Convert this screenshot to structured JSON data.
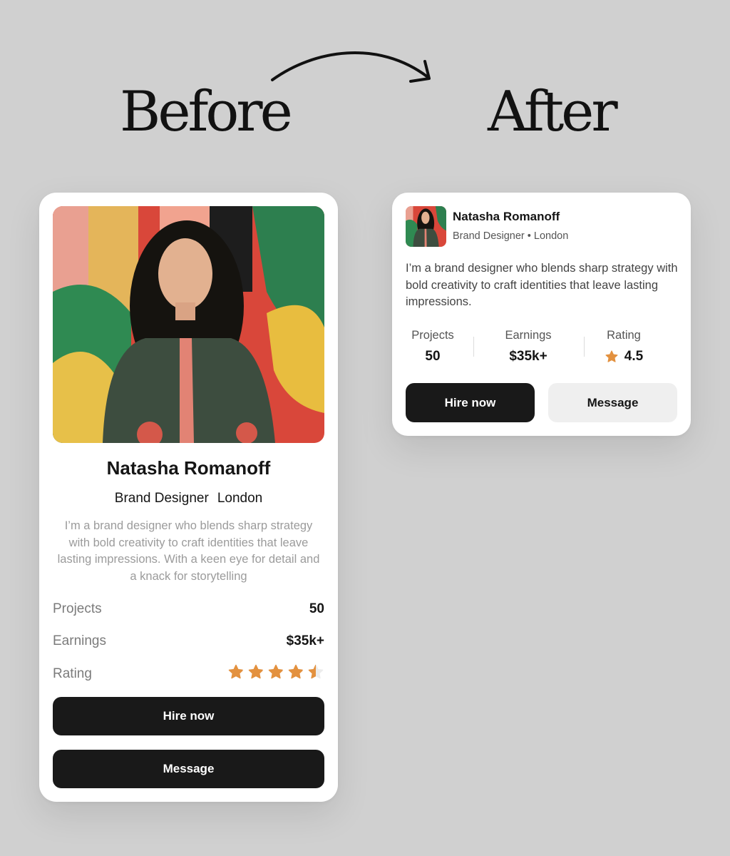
{
  "headings": {
    "before": "Before",
    "after": "After"
  },
  "colors": {
    "accent_star": "#e3913f",
    "button_dark": "#191919",
    "button_light": "#efefef",
    "background": "#d0d0d0"
  },
  "before_card": {
    "name": "Natasha Romanoff",
    "role": "Brand Designer",
    "location": "London",
    "bio": "I’m a brand designer who blends sharp strategy with bold creativity to craft identities that leave lasting impressions. With a keen eye for detail and a knack for storytelling",
    "stats": [
      {
        "label": "Projects",
        "value": "50"
      },
      {
        "label": "Earnings",
        "value": "$35k+"
      },
      {
        "label": "Rating",
        "value": 4.5,
        "icon": "star-icon"
      }
    ],
    "buttons": {
      "primary": "Hire now",
      "secondary": "Message"
    }
  },
  "after_card": {
    "name": "Natasha Romanoff",
    "role_location": "Brand Designer • London",
    "bio": "I’m a brand designer who blends sharp strategy with bold creativity to craft identities that leave lasting impressions.",
    "stats": [
      {
        "label": "Projects",
        "value": "50"
      },
      {
        "label": "Earnings",
        "value": "$35k+"
      },
      {
        "label": "Rating",
        "value": "4.5",
        "icon": "star-icon"
      }
    ],
    "buttons": {
      "primary": "Hire now",
      "secondary": "Message"
    }
  }
}
